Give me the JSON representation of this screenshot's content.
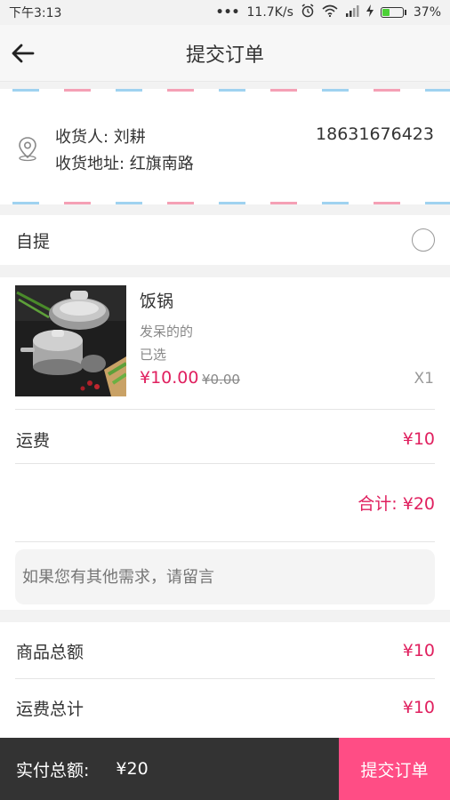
{
  "status_bar": {
    "time": "下午3:13",
    "dots": "•••",
    "network_speed": "11.7K/s",
    "battery_percent": "37%",
    "battery_level": 0.37,
    "icons": [
      "alarm-icon",
      "wifi-icon",
      "signal-icon",
      "charging-icon",
      "battery-icon"
    ]
  },
  "header": {
    "title": "提交订单",
    "back_icon": "back-arrow-icon"
  },
  "address": {
    "recipient_label": "收货人",
    "recipient_name": "刘耕",
    "phone": "18631676423",
    "address_label": "收货地址",
    "address_value": "红旗南路",
    "icon": "location-pin-icon"
  },
  "pickup": {
    "label": "自提",
    "selected": false
  },
  "product": {
    "name": "饭锅",
    "spec": "发呆的的",
    "status": "已选",
    "price": "¥10.00",
    "original_price": "¥0.00",
    "quantity": "X1"
  },
  "shipping": {
    "label": "运费",
    "value": "¥10"
  },
  "subtotal": {
    "label": "合计:",
    "value": "¥20"
  },
  "note": {
    "placeholder": "如果您有其他需求，请留言"
  },
  "summary": {
    "goods_total_label": "商品总额",
    "goods_total_value": "¥10",
    "shipping_total_label": "运费总计",
    "shipping_total_value": "¥10"
  },
  "bottom_bar": {
    "paid_label": "实付总额:",
    "paid_value": "¥20",
    "submit_label": "提交订单"
  },
  "colors": {
    "accent": "#e0205f",
    "submit_button": "#ff4d85",
    "bottom_bar": "#333333"
  }
}
